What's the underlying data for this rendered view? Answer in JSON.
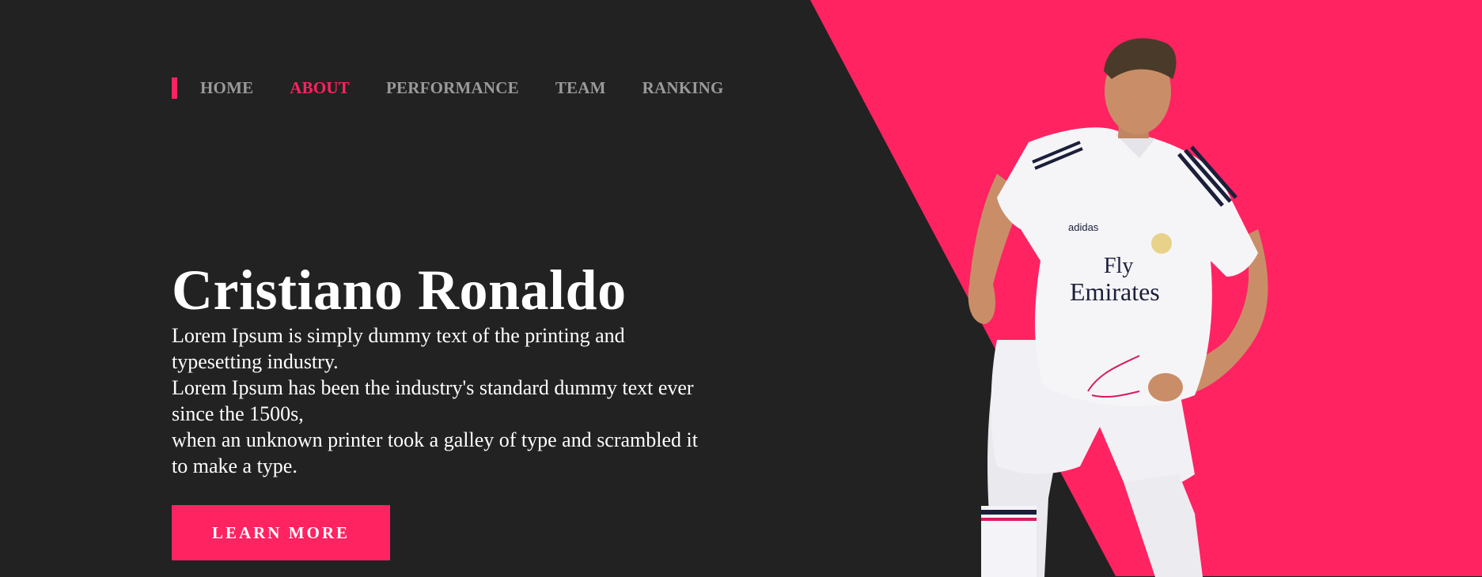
{
  "colors": {
    "background": "#222222",
    "accent": "#ff2361",
    "nav_inactive": "#9a9a9a",
    "text": "#ffffff"
  },
  "nav": {
    "items": [
      {
        "label": "HOME",
        "active": false
      },
      {
        "label": "ABOUT",
        "active": true
      },
      {
        "label": "PERFORMANCE",
        "active": false
      },
      {
        "label": "TEAM",
        "active": false
      },
      {
        "label": "RANKING",
        "active": false
      }
    ]
  },
  "hero": {
    "title": "Cristiano Ronaldo",
    "description_lines": [
      "Lorem Ipsum is simply dummy text of the printing and typesetting industry.",
      "Lorem Ipsum has been the industry's standard dummy text ever since the 1500s,",
      "when an unknown printer took a galley of type and scrambled it to make a type."
    ],
    "cta_label": "LEARN MORE"
  },
  "player_image": {
    "shirt_text": [
      "Fly",
      "Emirates"
    ],
    "brand_mark": "adidas"
  }
}
